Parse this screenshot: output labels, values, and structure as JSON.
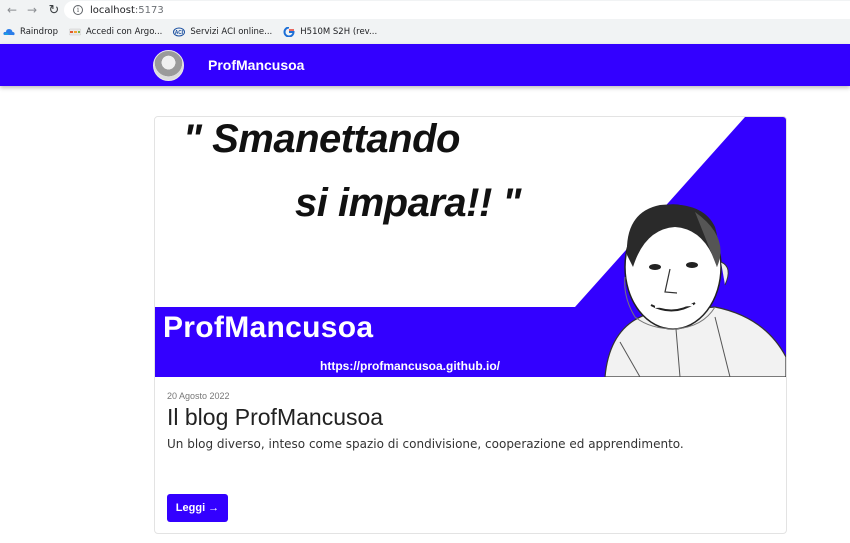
{
  "browser": {
    "url_host": "localhost",
    "url_port": ":5173",
    "bookmarks": [
      {
        "label": "Raindrop",
        "icon": "cloud-icon"
      },
      {
        "label": "Accedi con Argo...",
        "icon": "argo-icon"
      },
      {
        "label": "Servizi ACI online...",
        "icon": "aci-icon"
      },
      {
        "label": "H510M S2H (rev...",
        "icon": "gigabyte-icon"
      }
    ]
  },
  "navbar": {
    "brand": "ProfMancusoa",
    "color": "#3300ff"
  },
  "post": {
    "hero": {
      "quote_line1": "\" Smanettando",
      "quote_line2": "si impara!! \"",
      "brand": "ProfMancusoa",
      "url": "https://profmancusoa.github.io/"
    },
    "date": "20 Agosto 2022",
    "title": "Il blog ProfMancusoa",
    "description": "Un blog diverso, inteso come spazio di condivisione, cooperazione ed apprendimento.",
    "read_button": "Leggi →"
  }
}
